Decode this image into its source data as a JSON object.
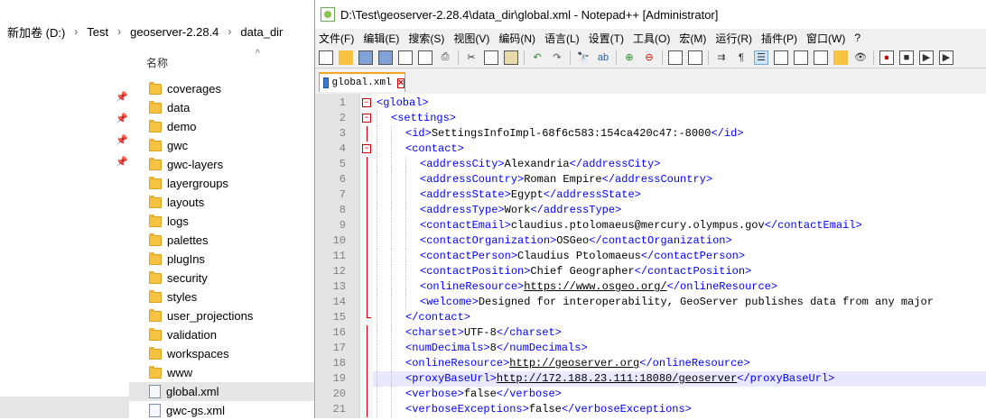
{
  "explorer": {
    "breadcrumb": [
      "新加卷 (D:)",
      "Test",
      "geoserver-2.28.4",
      "data_dir"
    ],
    "column_name": "名称",
    "items": [
      {
        "name": "coverages",
        "type": "folder"
      },
      {
        "name": "data",
        "type": "folder"
      },
      {
        "name": "demo",
        "type": "folder"
      },
      {
        "name": "gwc",
        "type": "folder"
      },
      {
        "name": "gwc-layers",
        "type": "folder"
      },
      {
        "name": "layergroups",
        "type": "folder"
      },
      {
        "name": "layouts",
        "type": "folder"
      },
      {
        "name": "logs",
        "type": "folder"
      },
      {
        "name": "palettes",
        "type": "folder"
      },
      {
        "name": "plugIns",
        "type": "folder"
      },
      {
        "name": "security",
        "type": "folder"
      },
      {
        "name": "styles",
        "type": "folder"
      },
      {
        "name": "user_projections",
        "type": "folder"
      },
      {
        "name": "validation",
        "type": "folder"
      },
      {
        "name": "workspaces",
        "type": "folder"
      },
      {
        "name": "www",
        "type": "folder"
      },
      {
        "name": "global.xml",
        "type": "xml",
        "selected": true
      },
      {
        "name": "gwc-gs.xml",
        "type": "xml"
      }
    ]
  },
  "notepad": {
    "title": "D:\\Test\\geoserver-2.28.4\\data_dir\\global.xml - Notepad++ [Administrator]",
    "menu": [
      "文件(F)",
      "编辑(E)",
      "搜索(S)",
      "视图(V)",
      "编码(N)",
      "语言(L)",
      "设置(T)",
      "工具(O)",
      "宏(M)",
      "运行(R)",
      "插件(P)",
      "窗口(W)",
      "?"
    ],
    "tab_label": "global.xml",
    "highlight_line": 19,
    "lines": [
      {
        "n": "1",
        "indent": 0,
        "fold": "open",
        "parts": [
          {
            "c": "t",
            "s": "<global>"
          }
        ]
      },
      {
        "n": "2",
        "indent": 1,
        "fold": "open",
        "parts": [
          {
            "c": "t",
            "s": "<settings>"
          }
        ]
      },
      {
        "n": "3",
        "indent": 2,
        "parts": [
          {
            "c": "t",
            "s": "<id>"
          },
          {
            "c": "v",
            "s": "SettingsInfoImpl-68f6c583:154ca420c47:-8000"
          },
          {
            "c": "t",
            "s": "</id>"
          }
        ]
      },
      {
        "n": "4",
        "indent": 2,
        "fold": "open",
        "parts": [
          {
            "c": "t",
            "s": "<contact>"
          }
        ]
      },
      {
        "n": "5",
        "indent": 3,
        "parts": [
          {
            "c": "t",
            "s": "<addressCity>"
          },
          {
            "c": "v",
            "s": "Alexandria"
          },
          {
            "c": "t",
            "s": "</addressCity>"
          }
        ]
      },
      {
        "n": "6",
        "indent": 3,
        "parts": [
          {
            "c": "t",
            "s": "<addressCountry>"
          },
          {
            "c": "v",
            "s": "Roman Empire"
          },
          {
            "c": "t",
            "s": "</addressCountry>"
          }
        ]
      },
      {
        "n": "7",
        "indent": 3,
        "parts": [
          {
            "c": "t",
            "s": "<addressState>"
          },
          {
            "c": "v",
            "s": "Egypt"
          },
          {
            "c": "t",
            "s": "</addressState>"
          }
        ]
      },
      {
        "n": "8",
        "indent": 3,
        "parts": [
          {
            "c": "t",
            "s": "<addressType>"
          },
          {
            "c": "v",
            "s": "Work"
          },
          {
            "c": "t",
            "s": "</addressType>"
          }
        ]
      },
      {
        "n": "9",
        "indent": 3,
        "parts": [
          {
            "c": "t",
            "s": "<contactEmail>"
          },
          {
            "c": "v",
            "s": "claudius.ptolomaeus@mercury.olympus.gov"
          },
          {
            "c": "t",
            "s": "</contactEmail>"
          }
        ]
      },
      {
        "n": "10",
        "indent": 3,
        "parts": [
          {
            "c": "t",
            "s": "<contactOrganization>"
          },
          {
            "c": "v",
            "s": "OSGeo"
          },
          {
            "c": "t",
            "s": "</contactOrganization>"
          }
        ]
      },
      {
        "n": "11",
        "indent": 3,
        "parts": [
          {
            "c": "t",
            "s": "<contactPerson>"
          },
          {
            "c": "v",
            "s": "Claudius Ptolomaeus"
          },
          {
            "c": "t",
            "s": "</contactPerson>"
          }
        ]
      },
      {
        "n": "12",
        "indent": 3,
        "parts": [
          {
            "c": "t",
            "s": "<contactPosition>"
          },
          {
            "c": "v",
            "s": "Chief Geographer"
          },
          {
            "c": "t",
            "s": "</contactPosition>"
          }
        ]
      },
      {
        "n": "13",
        "indent": 3,
        "parts": [
          {
            "c": "t",
            "s": "<onlineResource>"
          },
          {
            "c": "u",
            "s": "https://www.osgeo.org/"
          },
          {
            "c": "t",
            "s": "</onlineResource>"
          }
        ]
      },
      {
        "n": "14",
        "indent": 3,
        "parts": [
          {
            "c": "t",
            "s": "<welcome>"
          },
          {
            "c": "v",
            "s": "Designed for interoperability, GeoServer publishes data from any major"
          }
        ]
      },
      {
        "n": "15",
        "indent": 2,
        "fold": "end",
        "parts": [
          {
            "c": "t",
            "s": "</contact>"
          }
        ]
      },
      {
        "n": "16",
        "indent": 2,
        "parts": [
          {
            "c": "t",
            "s": "<charset>"
          },
          {
            "c": "v",
            "s": "UTF-8"
          },
          {
            "c": "t",
            "s": "</charset>"
          }
        ]
      },
      {
        "n": "17",
        "indent": 2,
        "parts": [
          {
            "c": "t",
            "s": "<numDecimals>"
          },
          {
            "c": "v",
            "s": "8"
          },
          {
            "c": "t",
            "s": "</numDecimals>"
          }
        ]
      },
      {
        "n": "18",
        "indent": 2,
        "parts": [
          {
            "c": "t",
            "s": "<onlineResource>"
          },
          {
            "c": "u",
            "s": "http://geoserver.org"
          },
          {
            "c": "t",
            "s": "</onlineResource>"
          }
        ]
      },
      {
        "n": "19",
        "indent": 2,
        "parts": [
          {
            "c": "t",
            "s": "<proxyBaseUrl>"
          },
          {
            "c": "u",
            "s": "http://172.188.23.111:18080/geoserver"
          },
          {
            "c": "t",
            "s": "</proxyBaseUrl>"
          }
        ]
      },
      {
        "n": "20",
        "indent": 2,
        "parts": [
          {
            "c": "t",
            "s": "<verbose>"
          },
          {
            "c": "v",
            "s": "false"
          },
          {
            "c": "t",
            "s": "</verbose>"
          }
        ]
      },
      {
        "n": "21",
        "indent": 2,
        "parts": [
          {
            "c": "t",
            "s": "<verboseExceptions>"
          },
          {
            "c": "v",
            "s": "false"
          },
          {
            "c": "t",
            "s": "</verboseExceptions>"
          }
        ]
      }
    ]
  }
}
